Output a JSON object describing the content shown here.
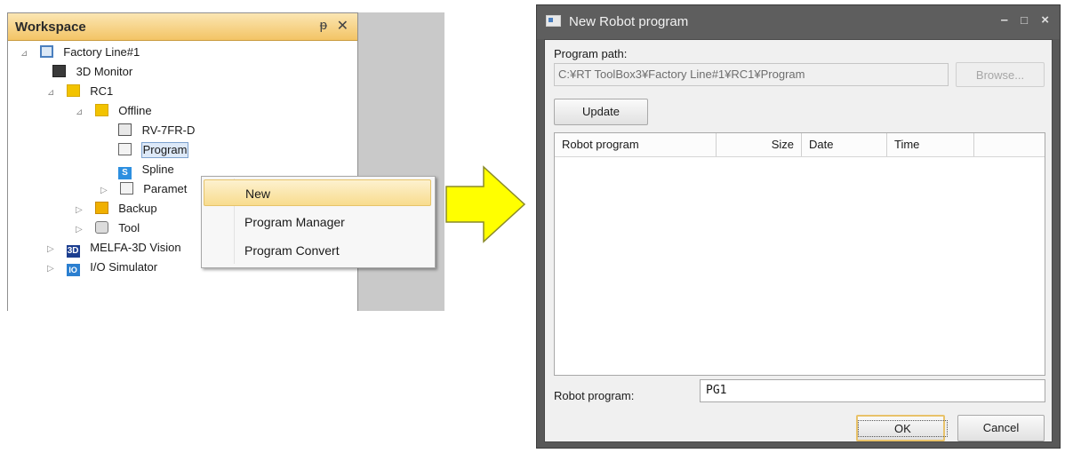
{
  "workspace": {
    "title": "Workspace",
    "pin_glyph": "ᵽ",
    "close_glyph": "✕",
    "tree": [
      {
        "label": "Factory Line#1",
        "icon": "workspace-icon"
      },
      {
        "label": "3D Monitor",
        "icon": "monitor-3d-icon"
      },
      {
        "label": "RC1",
        "icon": "controller-icon"
      },
      {
        "label": "Offline",
        "icon": "offline-icon"
      },
      {
        "label": "RV-7FR-D",
        "icon": "robot-icon"
      },
      {
        "label": "Program",
        "icon": "program-icon",
        "selected": true
      },
      {
        "label": "Spline",
        "icon": "spline-icon"
      },
      {
        "label": "Paramet",
        "icon": "parameter-icon"
      },
      {
        "label": "Backup",
        "icon": "backup-icon"
      },
      {
        "label": "Tool",
        "icon": "tool-icon"
      },
      {
        "label": "MELFA-3D Vision",
        "icon": "vision-icon"
      },
      {
        "label": "I/O Simulator",
        "icon": "io-simulator-icon"
      }
    ],
    "expander_open": "⊿",
    "expander_closed": "▷"
  },
  "context_menu": {
    "items": [
      {
        "label": "New",
        "highlighted": true
      },
      {
        "label": "Program Manager"
      },
      {
        "label": "Program Convert"
      }
    ]
  },
  "dialog": {
    "title": "New Robot program",
    "minimize_glyph": "–",
    "maximize_glyph": "□",
    "close_glyph": "×",
    "program_path_label": "Program path:",
    "program_path_value": "C:¥RT ToolBox3¥Factory Line#1¥RC1¥Program",
    "browse_label": "Browse...",
    "update_label": "Update",
    "columns": [
      "Robot program",
      "Size",
      "Date",
      "Time"
    ],
    "robot_program_label": "Robot program:",
    "robot_program_value": "PG1",
    "ok_label": "OK",
    "cancel_label": "Cancel"
  },
  "colors": {
    "header_gold": "#f3c465",
    "menu_highlight": "#f8dc8e",
    "arrow_fill": "#ffff00",
    "dialog_frame": "#585858"
  }
}
